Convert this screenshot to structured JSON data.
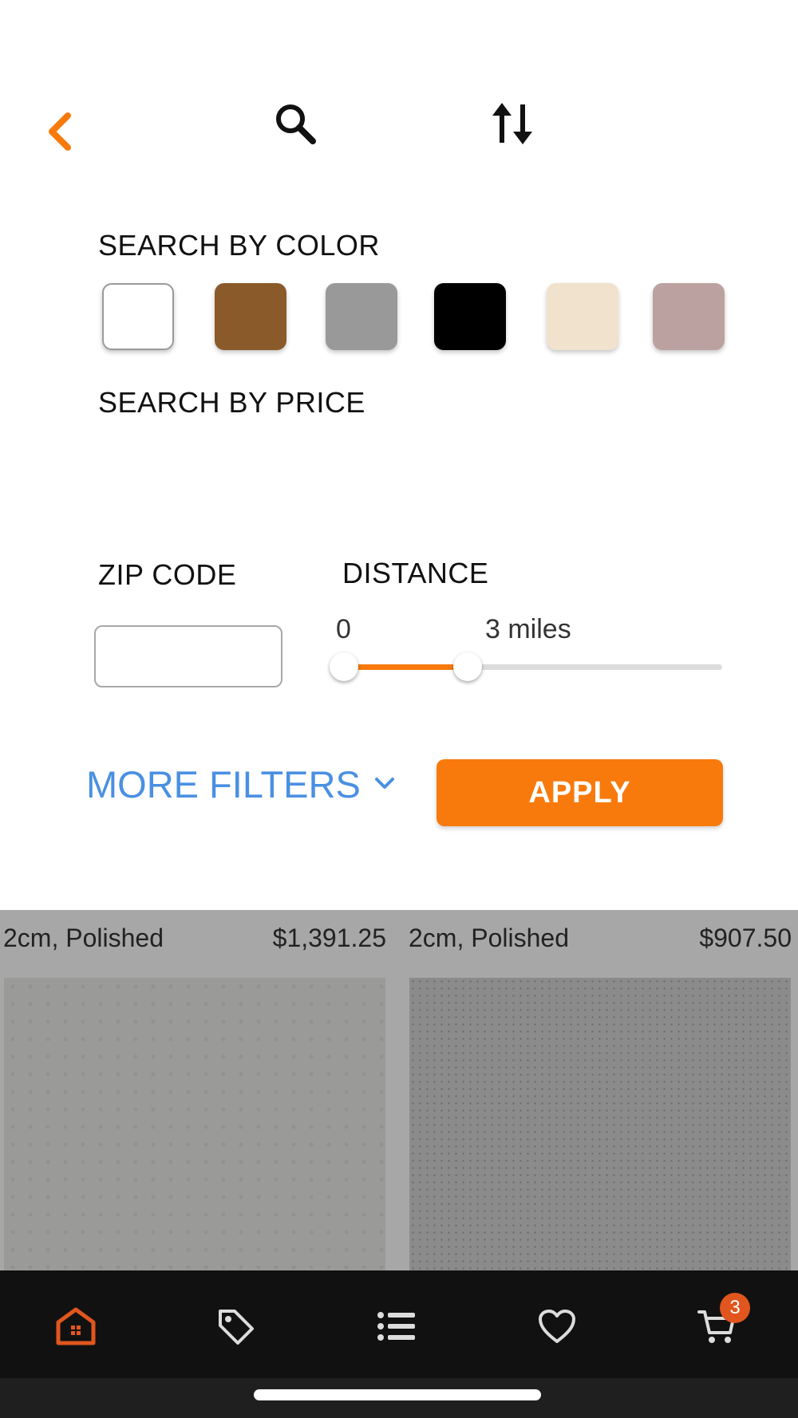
{
  "header": {
    "back_icon": "chevron-left-icon",
    "search_icon": "search-icon",
    "sort_icon": "sort-arrows-icon"
  },
  "filters": {
    "color_label": "SEARCH BY COLOR",
    "colors": [
      "#ffffff",
      "#8b5a2b",
      "#999999",
      "#000000",
      "#f0e2cc",
      "#bba2a0"
    ],
    "price_label": "SEARCH BY PRICE",
    "zip_label": "ZIP CODE",
    "zip_value": "",
    "distance_label": "DISTANCE",
    "distance_min_label": "0",
    "distance_value_label": "3 miles",
    "distance_fraction": 0.34,
    "more_filters_label": "MORE FILTERS",
    "apply_label": "APPLY"
  },
  "products": [
    {
      "spec": "2cm,  Polished",
      "price": "$1,391.25"
    },
    {
      "spec": "2cm,  Polished",
      "price": "$907.50"
    }
  ],
  "bottom_nav": {
    "items": [
      "home-icon",
      "tag-icon",
      "list-icon",
      "heart-icon",
      "cart-icon"
    ],
    "cart_count": "3"
  },
  "colors": {
    "accent": "#f87a0c",
    "link": "#4a90e2",
    "nav_bg": "#111111",
    "badge": "#e0561e"
  }
}
